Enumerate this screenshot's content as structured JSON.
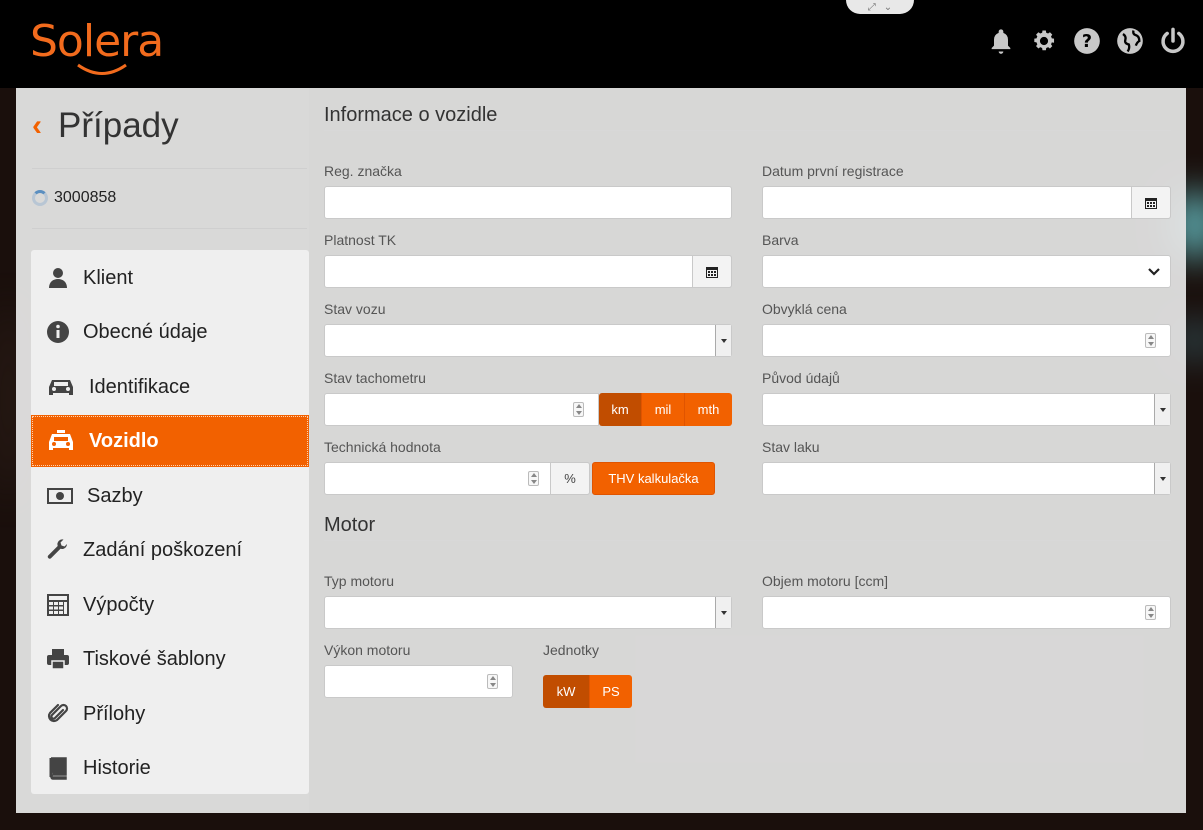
{
  "header": {
    "logo_text": "Solera",
    "icons": [
      "bell-icon",
      "gear-icon",
      "help-icon",
      "globe-icon",
      "power-icon"
    ]
  },
  "sidebar": {
    "back_icon": "chevron-left-icon",
    "title": "Případy",
    "case_number": "3000858",
    "items": [
      {
        "label": "Klient",
        "icon": "user-icon"
      },
      {
        "label": "Obecné údaje",
        "icon": "info-icon"
      },
      {
        "label": "Identifikace",
        "icon": "car-icon"
      },
      {
        "label": "Vozidlo",
        "icon": "taxi-icon",
        "active": true
      },
      {
        "label": "Sazby",
        "icon": "money-icon"
      },
      {
        "label": "Zadání poškození",
        "icon": "wrench-icon"
      },
      {
        "label": "Výpočty",
        "icon": "calculator-icon"
      },
      {
        "label": "Tiskové šablony",
        "icon": "printer-icon"
      },
      {
        "label": "Přílohy",
        "icon": "paperclip-icon"
      },
      {
        "label": "Historie",
        "icon": "book-icon"
      }
    ]
  },
  "vehicle": {
    "section_title": "Informace o vozidle",
    "reg_label": "Reg. značka",
    "first_reg_label": "Datum první registrace",
    "tk_label": "Platnost TK",
    "color_label": "Barva",
    "condition_label": "Stav vozu",
    "usual_price_label": "Obvyklá cena",
    "odometer_label": "Stav tachometru",
    "odometer_units": [
      "km",
      "mil",
      "mth"
    ],
    "data_origin_label": "Původ údajů",
    "tech_value_label": "Technická hodnota",
    "percent": "%",
    "thv_button": "THV kalkulačka",
    "paint_label": "Stav laku"
  },
  "engine": {
    "section_title": "Motor",
    "type_label": "Typ motoru",
    "volume_label": "Objem motoru [ccm]",
    "power_label": "Výkon motoru",
    "units_label": "Jednotky",
    "units": [
      "kW",
      "PS"
    ]
  },
  "colors": {
    "accent": "#f26100",
    "accent_dark": "#c14d00"
  }
}
